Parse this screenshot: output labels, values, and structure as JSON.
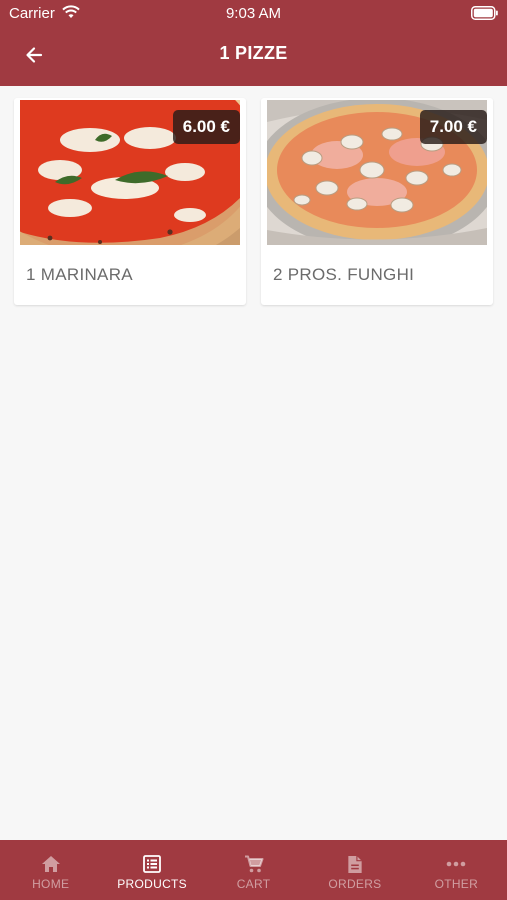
{
  "status_bar": {
    "carrier": "Carrier",
    "time": "9:03 AM"
  },
  "header": {
    "title": "1 PIZZE",
    "back_icon": "arrow-left-icon",
    "background_color": "#a03a41"
  },
  "products": [
    {
      "name": "1 MARINARA",
      "price": "6.00 €"
    },
    {
      "name": "2 PROS. FUNGHI",
      "price": "7.00 €"
    }
  ],
  "tab_bar": {
    "tabs": [
      {
        "label": "HOME",
        "icon": "home-icon",
        "active": false
      },
      {
        "label": "PRODUCTS",
        "icon": "list-icon",
        "active": true
      },
      {
        "label": "CART",
        "icon": "cart-icon",
        "active": false
      },
      {
        "label": "ORDERS",
        "icon": "document-icon",
        "active": false
      },
      {
        "label": "OTHER",
        "icon": "more-icon",
        "active": false
      }
    ]
  }
}
